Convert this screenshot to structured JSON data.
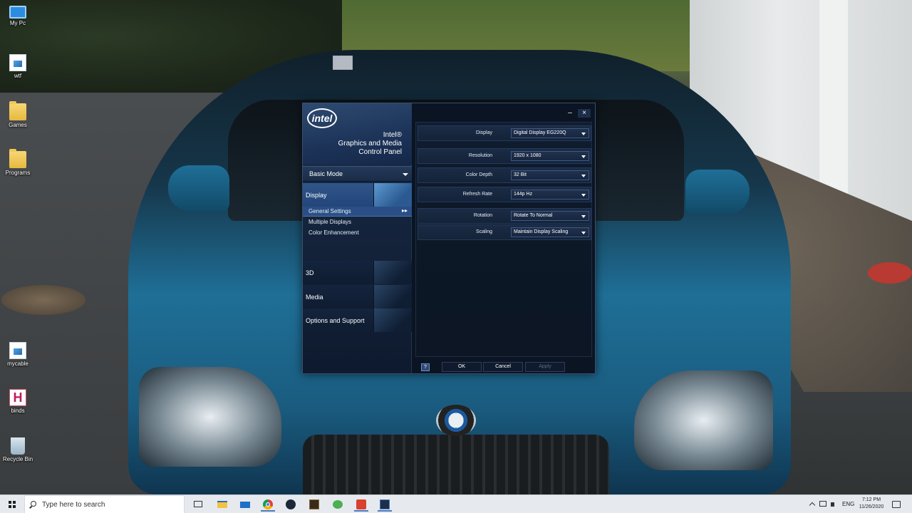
{
  "desktop": {
    "icons": [
      {
        "label": "My Pc",
        "icon": "computer-icon"
      },
      {
        "label": "wtf",
        "icon": "image-file-icon"
      },
      {
        "label": "Games",
        "icon": "folder-icon"
      },
      {
        "label": "Programs",
        "icon": "folder-icon"
      },
      {
        "label": "mycable",
        "icon": "image-file-icon"
      },
      {
        "label": "binds",
        "icon": "h-file-icon"
      },
      {
        "label": "Recycle Bin",
        "icon": "recycle-bin-icon"
      }
    ]
  },
  "intel": {
    "logo_text": "intel",
    "brand_line1": "Intel®",
    "brand_line2": "Graphics and Media",
    "brand_line3": "Control Panel",
    "mode": "Basic Mode",
    "nav": {
      "display": "Display",
      "sub_general": "General Settings",
      "sub_multiple": "Multiple Displays",
      "sub_color": "Color Enhancement",
      "three_d": "3D",
      "media": "Media",
      "options": "Options and Support"
    },
    "settings": {
      "display": {
        "label": "Display",
        "value": "Digital Display EG220Q"
      },
      "resolution": {
        "label": "Resolution",
        "value": "1920 x 1080"
      },
      "color_depth": {
        "label": "Color Depth",
        "value": "32 Bit"
      },
      "refresh_rate": {
        "label": "Refresh Rate",
        "value": "144p Hz"
      },
      "rotation": {
        "label": "Rotation",
        "value": "Rotate To Normal"
      },
      "scaling": {
        "label": "Scaling",
        "value": "Maintain Display Scaling"
      }
    },
    "buttons": {
      "help": "?",
      "ok": "OK",
      "cancel": "Cancel",
      "apply": "Apply"
    },
    "window_controls": {
      "minimize": "–",
      "close": "×"
    }
  },
  "taskbar": {
    "search_placeholder": "Type here to search",
    "language": "ENG",
    "time": "7:12 PM",
    "date": "11/26/2020",
    "apps": [
      "task-view-icon",
      "file-explorer-icon",
      "mail-icon",
      "chrome-icon",
      "steam-icon",
      "game-icon",
      "frog-icon",
      "red-app-icon",
      "intel-app-icon"
    ]
  },
  "colors": {
    "window_bg": "#0b1422",
    "nav_selected": "#2f5689",
    "taskbar_bg": "#e6eaee",
    "car_blue": "#1f6f97"
  }
}
